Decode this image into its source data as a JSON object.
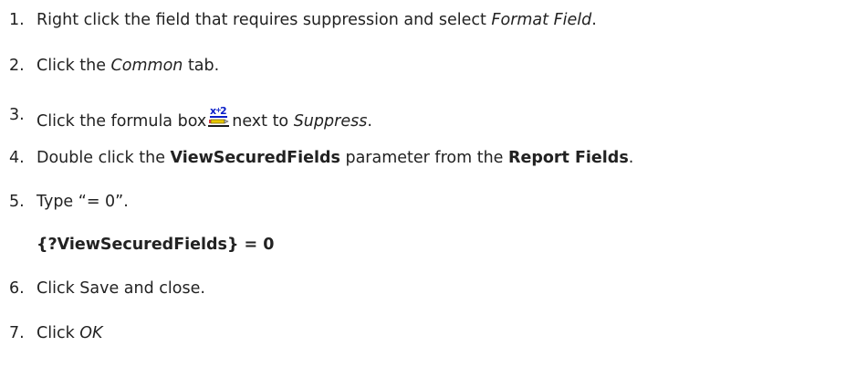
{
  "steps": [
    {
      "num": "1.",
      "a": "Right click the field that requires suppression and select ",
      "b": "Format Field",
      "c": "."
    },
    {
      "num": "2.",
      "a": "Click the ",
      "b": "Common",
      "c": " tab."
    },
    {
      "num": "3.",
      "a": "Click the formula box",
      "icon": "formula-button-icon",
      "b": "next to ",
      "c": "Suppress",
      "d": "."
    },
    {
      "num": "4.",
      "a": "Double click the ",
      "b": "ViewSecuredFields",
      "c": " parameter from the ",
      "d": "Report Fields",
      "e": "."
    },
    {
      "num": "5.",
      "a": "Type “= 0”."
    },
    {
      "num": "6.",
      "a": "Click Save and close."
    },
    {
      "num": "7.",
      "a": "Click ",
      "b": "OK"
    }
  ],
  "formula_example": "{?ViewSecuredFields} = 0",
  "colors": {
    "text": "#222222",
    "icon_blue": "#0a1ec8",
    "icon_yellow": "#e8c800",
    "icon_gray": "#b8b8b8"
  }
}
